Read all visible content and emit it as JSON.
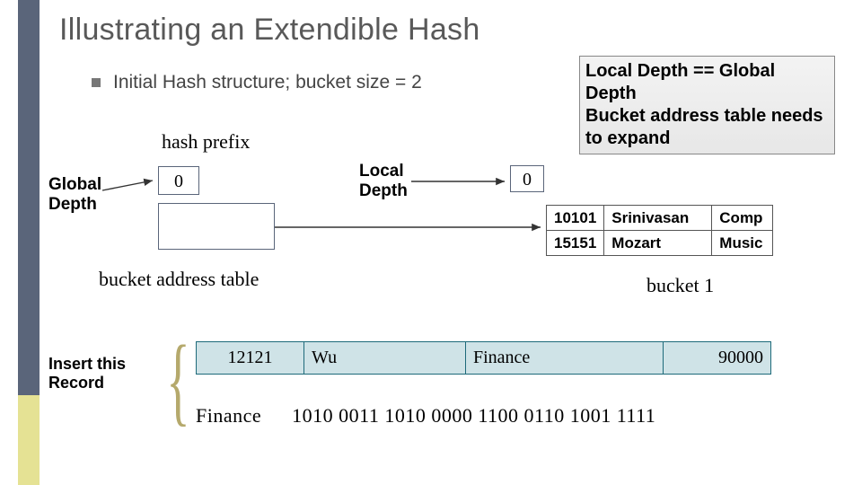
{
  "title": "Illustrating an Extendible Hash",
  "bullet": "Initial  Hash structure; bucket size = 2",
  "callout": "Local Depth == Global Depth\nBucket address table needs to expand",
  "labels": {
    "hash_prefix": "hash prefix",
    "global_depth": "Global\nDepth",
    "local_depth": "Local\nDepth",
    "bat": "bucket address table",
    "bucket1": "bucket 1",
    "insert": "Insert this\nRecord"
  },
  "global_depth_val": "0",
  "local_depth_val": "0",
  "bucket1_rows": [
    {
      "id": "10101",
      "name": "Srinivasan",
      "dept": "Comp"
    },
    {
      "id": "15151",
      "name": "Mozart",
      "dept": "Music"
    }
  ],
  "record": {
    "id": "12121",
    "name": "Wu",
    "dept": "Finance",
    "salary": "90000"
  },
  "bits_dept": "Finance",
  "bits": "1010 0011 1010 0000 1100 0110 1001 1111"
}
